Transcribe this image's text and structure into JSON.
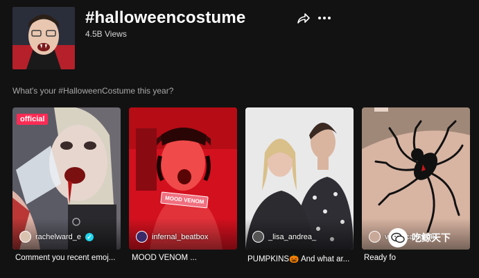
{
  "hashtag": {
    "title": "#halloweencostume",
    "views": "4.5B Views",
    "description": "What's your #HalloweenCostume this year?"
  },
  "header_icons": [
    "share-icon",
    "more-icon"
  ],
  "videos": [
    {
      "username": "rachelward_e",
      "verified": true,
      "badge": "official",
      "caption": "Comment you recent emoj..."
    },
    {
      "username": "infernal_beatbox",
      "overlay": "MOOD VENOM",
      "caption": "MOOD VENOM ..."
    },
    {
      "username": "_lisa_andrea_",
      "caption": "PUMPKINS🎃 And what ar..."
    },
    {
      "username": "veronica.dambr",
      "caption": "Ready fo"
    }
  ],
  "watermark": {
    "text": "吃鲸天下",
    "icon": "wechat-icon"
  },
  "colors": {
    "background": "#121212",
    "badge": "#fe2c55",
    "verified": "#20d5ec"
  }
}
